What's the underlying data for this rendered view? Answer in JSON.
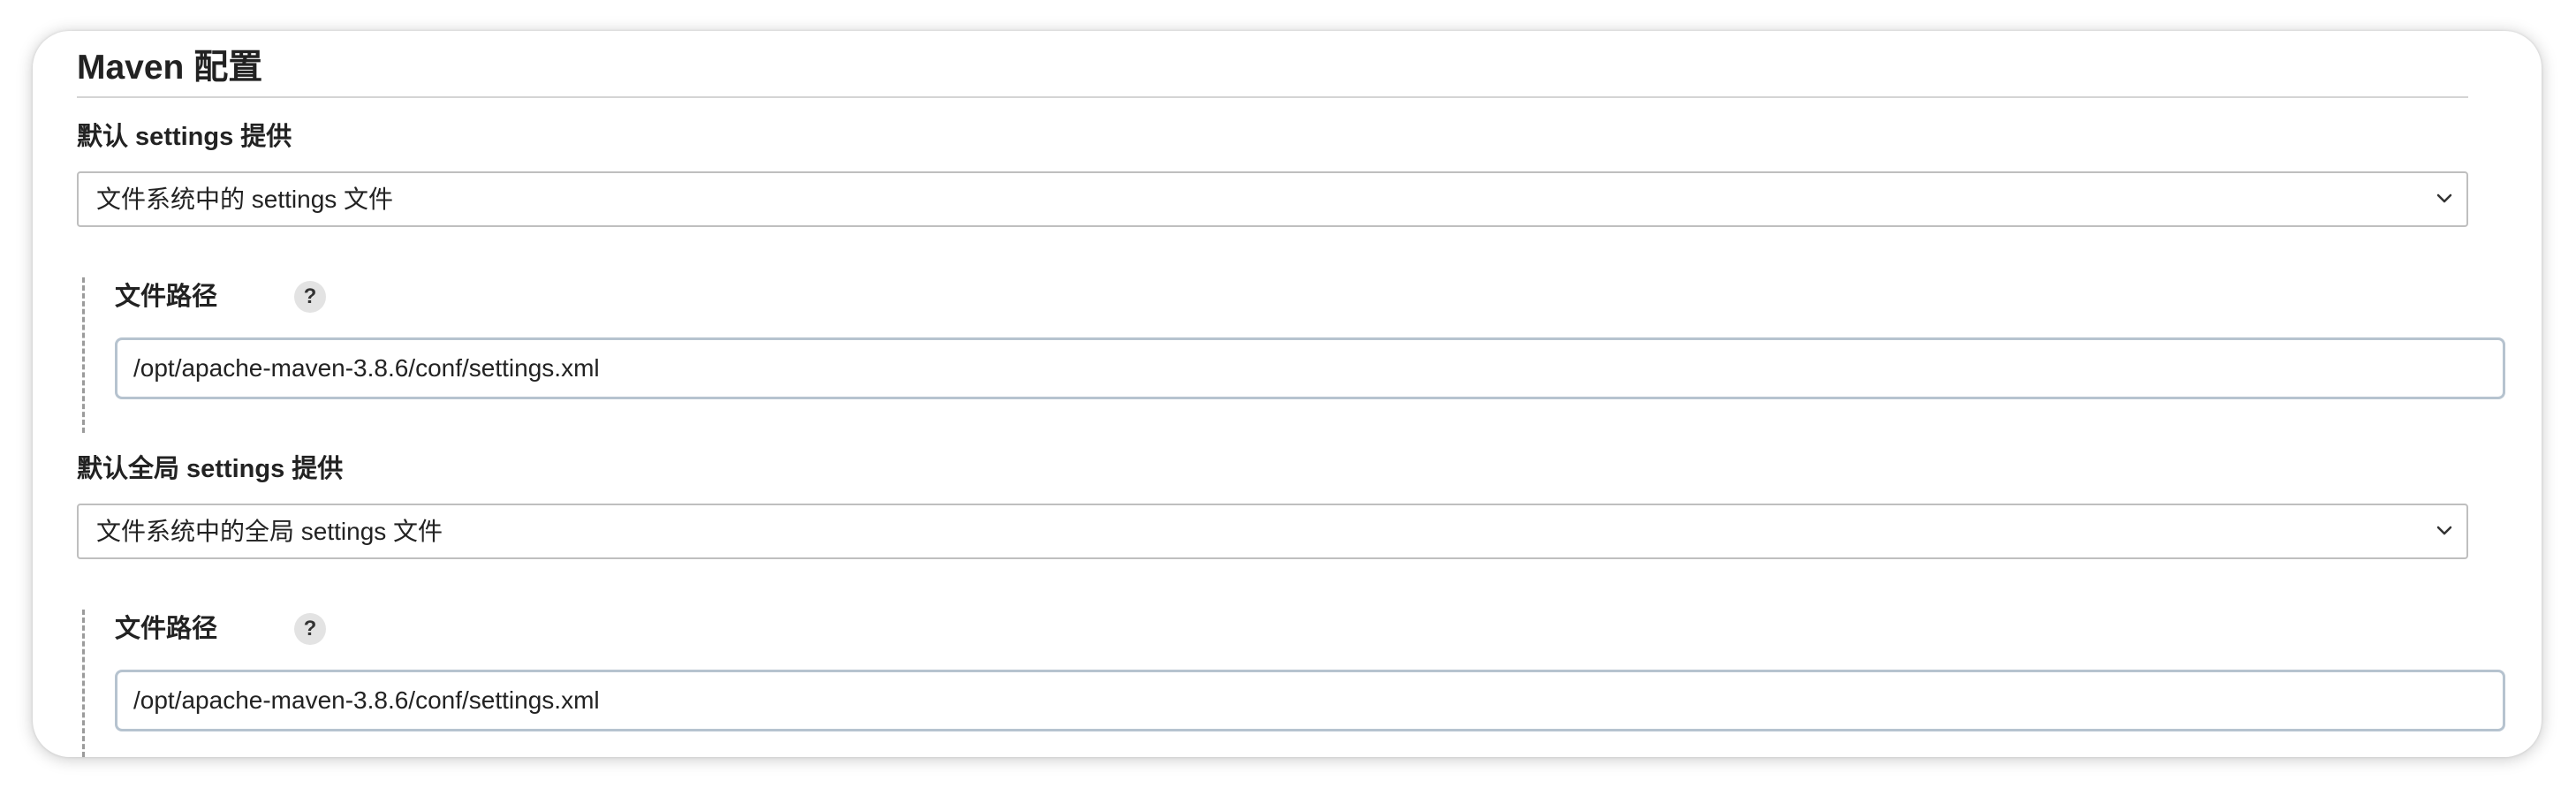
{
  "section": {
    "title": "Maven 配置"
  },
  "user_settings": {
    "label": "默认 settings 提供",
    "selected": "文件系统中的 settings 文件",
    "path_label": "文件路径",
    "help": "?",
    "path_value": "/opt/apache-maven-3.8.6/conf/settings.xml"
  },
  "global_settings": {
    "label": "默认全局 settings 提供",
    "selected": "文件系统中的全局 settings 文件",
    "path_label": "文件路径",
    "help": "?",
    "path_value": "/opt/apache-maven-3.8.6/conf/settings.xml"
  },
  "icons": {
    "dropdown": "chevron-down-icon",
    "help": "help-icon"
  },
  "colors": {
    "text": "#222222",
    "input_border": "#b6c3cf",
    "select_border": "#bfbfbf",
    "dashed_indent": "#9b9b9b",
    "help_badge_bg": "#e3e3e3"
  }
}
